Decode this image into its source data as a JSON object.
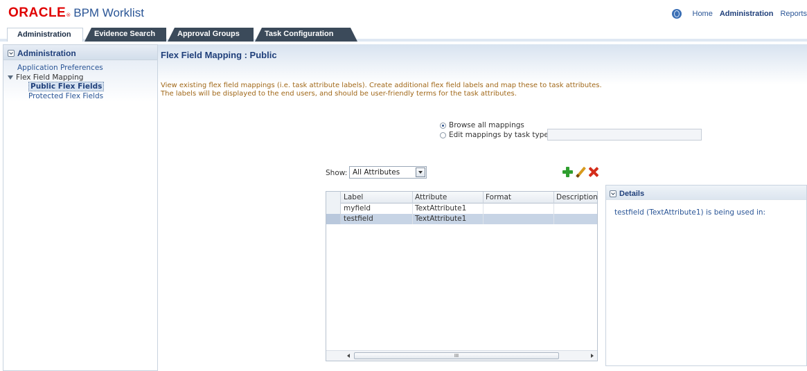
{
  "header": {
    "logo_oracle": "ORACLE",
    "logo_reg": "®",
    "app_name": "BPM Worklist",
    "links": [
      "Home",
      "Administration",
      "Reports"
    ]
  },
  "tabs": [
    {
      "label": "Administration",
      "active": true
    },
    {
      "label": "Evidence Search",
      "active": false
    },
    {
      "label": "Approval Groups",
      "active": false
    },
    {
      "label": "Task Configuration",
      "active": false
    }
  ],
  "sidebar": {
    "title": "Administration",
    "items": {
      "app_prefs": "Application Preferences",
      "flex_mapping": "Flex Field Mapping",
      "public_flex": "Public Flex Fields",
      "protected_flex": "Protected Flex Fields"
    }
  },
  "main": {
    "title": "Flex Field Mapping : Public",
    "description_line1": "View existing flex field mappings (i.e. task attribute labels). Create additional flex field labels and map these to task attributes.",
    "description_line2": "The labels will be displayed to the end users, and should be user-friendly terms for the task attributes.",
    "radio_browse": "Browse all mappings",
    "radio_edit": "Edit mappings by task type:",
    "show_label": "Show:",
    "show_value": "All Attributes"
  },
  "table": {
    "columns": [
      "Label",
      "Attribute",
      "Format",
      "Description"
    ],
    "rows": [
      {
        "label": "myfield",
        "attribute": "TextAttribute1",
        "format": "",
        "description": ""
      },
      {
        "label": "testfield",
        "attribute": "TextAttribute1",
        "format": "",
        "description": ""
      }
    ],
    "selected_row": 1,
    "scroll_thumb_label": "III"
  },
  "details": {
    "title": "Details",
    "text": "testfield (TextAttribute1) is being used in:"
  },
  "colors": {
    "brand_red": "#e00000",
    "link_blue": "#2a5596",
    "description_orange": "#a06718",
    "selected_row": "#c7d4e5"
  }
}
